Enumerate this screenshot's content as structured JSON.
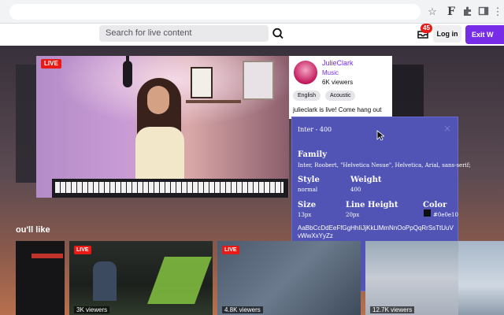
{
  "browser": {
    "icons": [
      "star-icon",
      "extension-f-icon",
      "puzzle-icon",
      "sidebar-icon",
      "menu-icon"
    ]
  },
  "header": {
    "search_placeholder": "Search for live content",
    "notifications_count": "45",
    "login_label": "Log in",
    "exit_label": "Exit W"
  },
  "featured": {
    "live_label": "LIVE",
    "channel": "JulieClark",
    "category": "Music",
    "viewers": "6K viewers",
    "tags": [
      "English",
      "Acoustic"
    ],
    "title": "julieclark is live! Come hang out"
  },
  "inspector": {
    "heading": "Inter - 400",
    "close": "×",
    "family_label": "Family",
    "family_value": "Inter, Roobert, \"Helvetica Nesue\", Helvetica, Arial, sans-serif;",
    "style_label": "Style",
    "style_value": "normal",
    "weight_label": "Weight",
    "weight_value": "400",
    "size_label": "Size",
    "size_value": "13px",
    "line_height_label": "Line Height",
    "line_height_value": "20px",
    "color_label": "Color",
    "color_value": "#0e0e10",
    "sample_text": "AaBbCcDdEeFfGgHhIiJjKkLlMmNnOoPpQqRrSsTtUuVvWwXxYyZz"
  },
  "section": {
    "heading": "ou'll like",
    "cards": [
      {
        "live": "",
        "viewers": ""
      },
      {
        "live": "LIVE",
        "viewers": "3K viewers"
      },
      {
        "live": "LIVE",
        "viewers": "4.8K viewers"
      },
      {
        "live": "",
        "viewers": "12.7K viewers"
      },
      {
        "live": "",
        "viewers": ""
      }
    ]
  },
  "colors": {
    "brand": "#772ce8",
    "live": "#e91916",
    "inspector_bg": "#5154b5"
  }
}
